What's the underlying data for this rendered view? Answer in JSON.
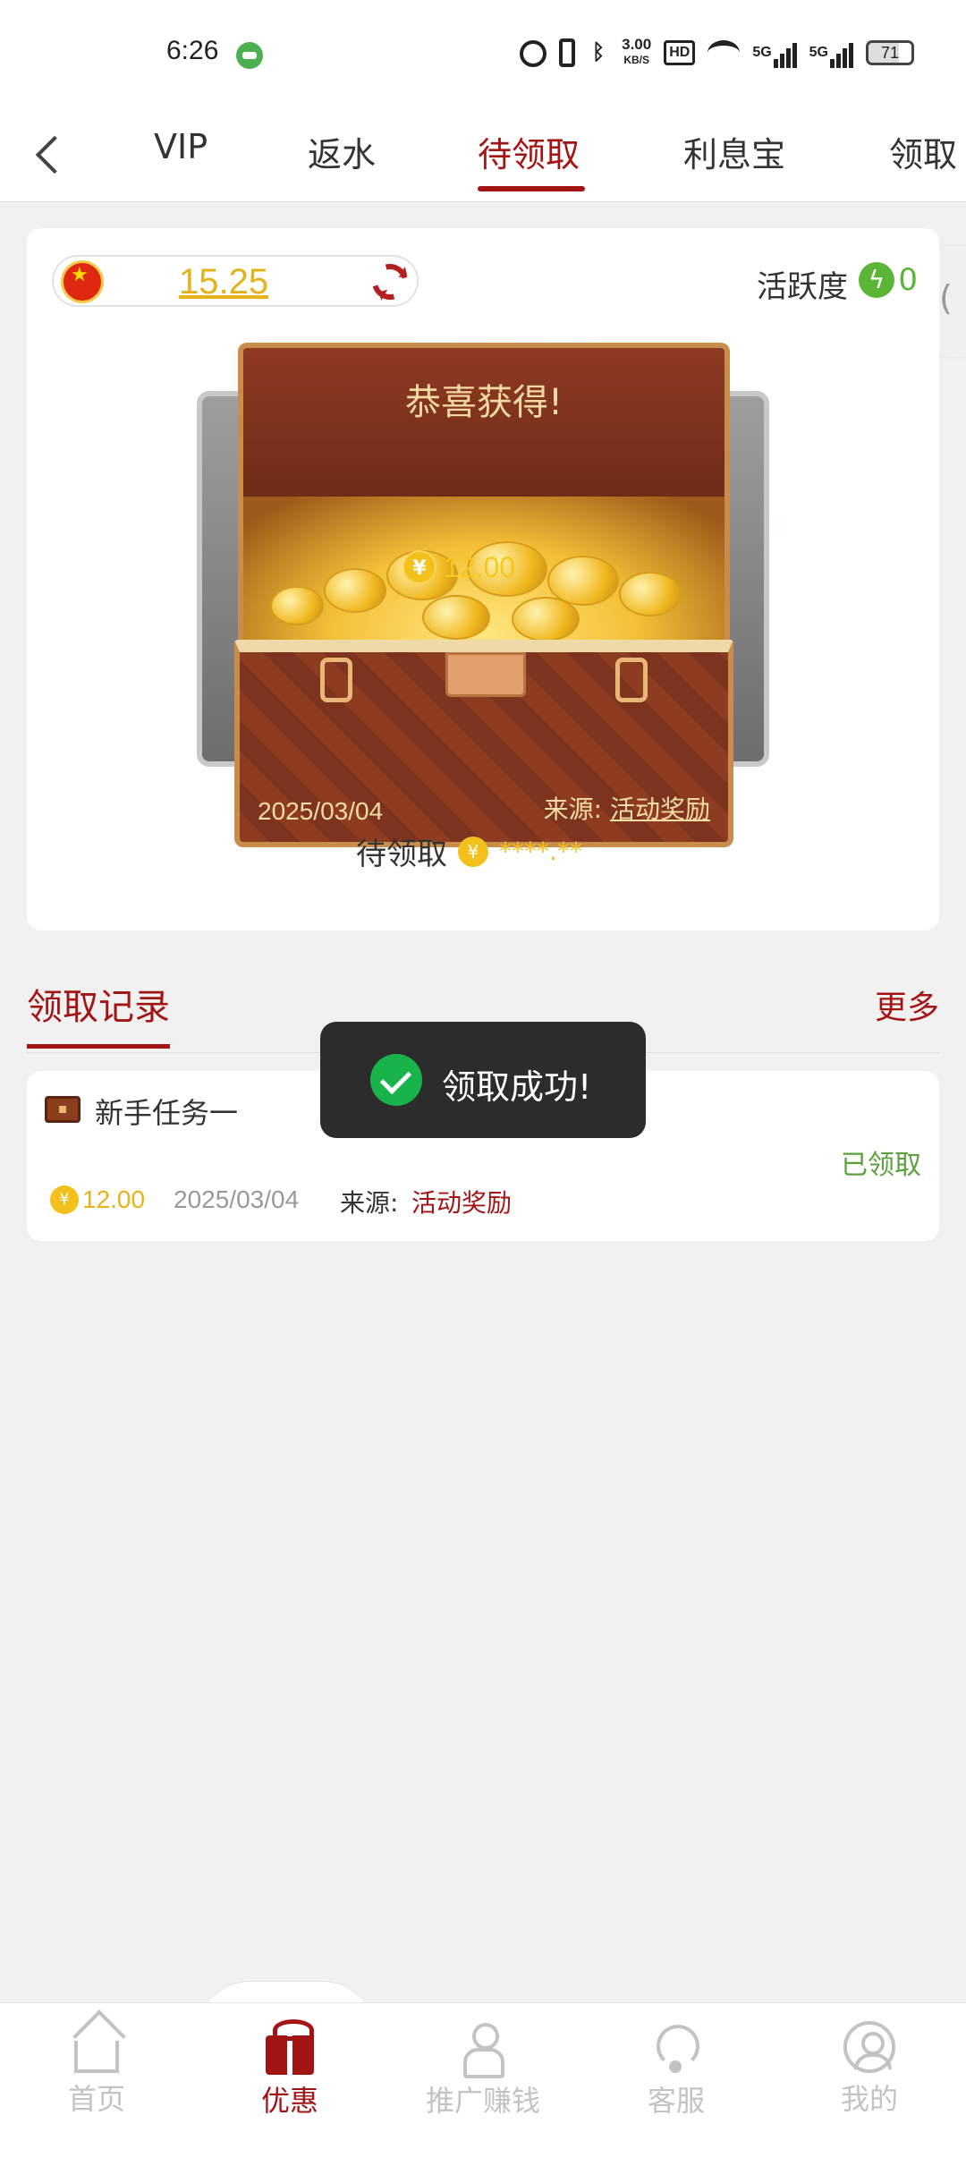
{
  "status_bar": {
    "time": "6:26",
    "net_speed": "3.00",
    "net_speed_unit": "KB/S",
    "hd_badge": "HD",
    "signal_1": "5G",
    "signal_2": "5G",
    "battery": "71"
  },
  "tabs": [
    {
      "label": "VIP",
      "active": false
    },
    {
      "label": "返水",
      "active": false
    },
    {
      "label": "待领取",
      "active": true
    },
    {
      "label": "利息宝",
      "active": false
    },
    {
      "label": "领取",
      "active": false
    }
  ],
  "balance": {
    "value": "15.25"
  },
  "activity": {
    "label": "活跃度",
    "value": "0"
  },
  "chest": {
    "title": "恭喜获得!",
    "amount": "12.00",
    "date": "2025/03/04",
    "source_label": "来源:",
    "source_value": "活动奖励",
    "pending_label": "待领取",
    "pending_value": "****.**"
  },
  "records": {
    "title": "领取记录",
    "more": "更多",
    "items": [
      {
        "name": "新手任务一",
        "status": "已领取",
        "amount": "12.00",
        "date": "2025/03/04",
        "source_label": "来源:",
        "source_value": "活动奖励"
      }
    ]
  },
  "toast": {
    "text": "领取成功!"
  },
  "bottom_nav": [
    {
      "label": "首页",
      "icon": "home-icon",
      "active": false
    },
    {
      "label": "优惠",
      "icon": "gift-icon",
      "active": true
    },
    {
      "label": "推广赚钱",
      "icon": "people-icon",
      "active": false
    },
    {
      "label": "客服",
      "icon": "headset-icon",
      "active": false
    },
    {
      "label": "我的",
      "icon": "user-icon",
      "active": false
    }
  ],
  "colors": {
    "accent": "#a31515",
    "gold": "#e9b21a",
    "success": "#19b34c",
    "claimed": "#5aa03c"
  }
}
